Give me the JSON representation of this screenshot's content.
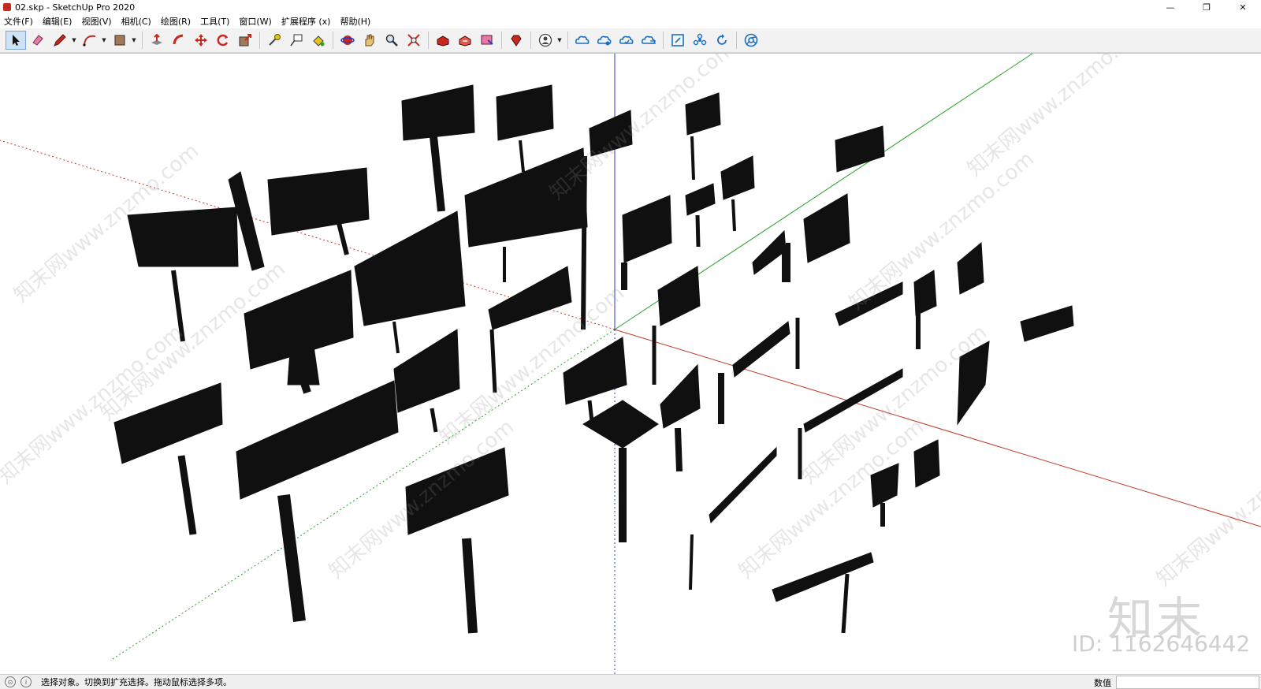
{
  "window": {
    "title": "02.skp - SketchUp Pro 2020",
    "minimize_glyph": "—",
    "restore_glyph": "❐",
    "close_glyph": "✕"
  },
  "menu": [
    {
      "label": "文件(F)"
    },
    {
      "label": "编辑(E)"
    },
    {
      "label": "视图(V)"
    },
    {
      "label": "相机(C)"
    },
    {
      "label": "绘图(R)"
    },
    {
      "label": "工具(T)"
    },
    {
      "label": "窗口(W)"
    },
    {
      "label": "扩展程序 (x)"
    },
    {
      "label": "帮助(H)"
    }
  ],
  "toolbar": {
    "groups": [
      [
        "select-icon",
        "eraser-icon",
        "pencil-icon",
        "arc-icon",
        "paint-bucket-icon"
      ],
      [
        "push-pull-icon",
        "follow-me-icon",
        "move-icon",
        "rotate-icon",
        "scale-icon"
      ],
      [
        "tape-measure-icon",
        "text-icon",
        "paint-icon"
      ],
      [
        "orbit-icon",
        "pan-icon",
        "zoom-icon",
        "zoom-extents-icon"
      ],
      [
        "warehouse-icon",
        "extension-warehouse-icon",
        "layout-icon"
      ],
      [
        "ruby-icon"
      ],
      [
        "account-icon"
      ],
      [
        "cloud-share-icon",
        "cloud-connect-icon",
        "cloud-sync-icon",
        "cloud-list-icon"
      ],
      [
        "section-icon",
        "components-icon",
        "refresh-icon"
      ],
      [
        "chrome-icon"
      ]
    ],
    "accent": "#1a6fc4"
  },
  "viewport": {
    "axis_colors": {
      "red": "#c0392b",
      "green": "#2aa02a",
      "blue": "#2a3fbf"
    },
    "watermark_text": "知末网www.znzmo.com",
    "brand_text": "知末",
    "id_text": "ID: 1162646442",
    "model_color": "#101010"
  },
  "status": {
    "message": "选择对象。切换到扩充选择。拖动鼠标选择多项。",
    "measure_label": "数值",
    "measure_value": ""
  }
}
